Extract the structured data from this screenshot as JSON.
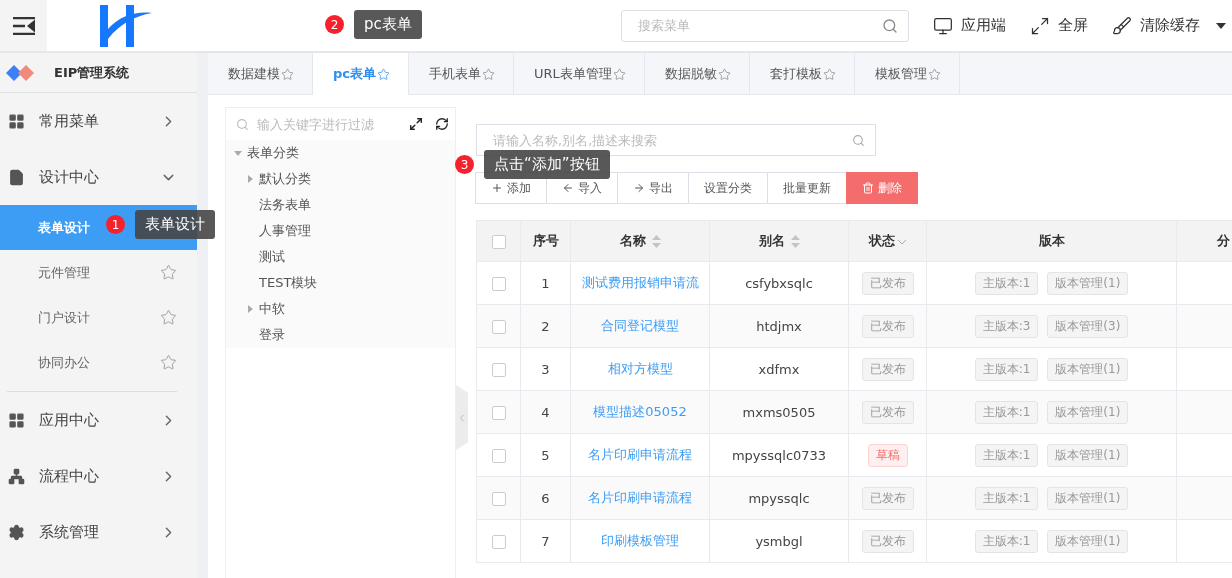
{
  "header": {
    "search": {
      "placeholder": "搜索菜单"
    },
    "actions": [
      {
        "label": "应用端"
      },
      {
        "label": "全屏"
      },
      {
        "label": "清除缓存",
        "dropdown": true
      }
    ]
  },
  "steps": [
    {
      "number": "2",
      "text": "pc表单"
    },
    {
      "number": "3",
      "text": "点击“添加”按钮"
    },
    {
      "number": "1",
      "text": "表单设计"
    }
  ],
  "sidebar": {
    "brand": "EIP管理系统",
    "menu": [
      {
        "label": "常用菜单",
        "expanded": false
      },
      {
        "label": "设计中心",
        "expanded": true,
        "children": [
          {
            "label": "表单设计",
            "selected": true
          },
          {
            "label": "元件管理",
            "selected": false
          },
          {
            "label": "门户设计",
            "selected": false
          },
          {
            "label": "协同办公",
            "selected": false
          }
        ]
      },
      {
        "label": "应用中心",
        "expanded": false
      },
      {
        "label": "流程中心",
        "expanded": false
      },
      {
        "label": "系统管理",
        "expanded": false
      }
    ]
  },
  "tabs": [
    {
      "label": "数据建模",
      "selected": false
    },
    {
      "label": "pc表单",
      "selected": true
    },
    {
      "label": "手机表单",
      "selected": false
    },
    {
      "label": "URL表单管理",
      "selected": false
    },
    {
      "label": "数据脱敏",
      "selected": false
    },
    {
      "label": "套打模板",
      "selected": false
    },
    {
      "label": "模板管理",
      "selected": false
    }
  ],
  "tree": {
    "placeholder": "输入关键字进行过滤",
    "nodes": [
      {
        "label": "表单分类",
        "expanded": true,
        "children": [
          {
            "label": "默认分类",
            "expanded": false
          },
          {
            "label": "法务表单"
          },
          {
            "label": "人事管理"
          },
          {
            "label": "测试"
          },
          {
            "label": "TEST模块"
          },
          {
            "label": "中软",
            "expanded": false
          },
          {
            "label": "登录"
          }
        ]
      }
    ]
  },
  "search": {
    "placeholder": "请输入名称,别名,描述来搜索"
  },
  "toolbar": [
    {
      "label": "添加",
      "kind": "add"
    },
    {
      "label": "导入",
      "kind": "import"
    },
    {
      "label": "导出",
      "kind": "export"
    },
    {
      "label": "设置分类",
      "kind": "plain"
    },
    {
      "label": "批量更新",
      "kind": "plain"
    },
    {
      "label": "删除",
      "kind": "danger"
    }
  ],
  "table": {
    "all_checked": false,
    "columns": [
      {
        "label": "序号"
      },
      {
        "label": "名称",
        "sortable": true
      },
      {
        "label": "别名",
        "sortable": true
      },
      {
        "label": "状态",
        "filterable": true
      },
      {
        "label": "版本"
      },
      {
        "label": "分"
      }
    ],
    "rows": [
      {
        "checked": false,
        "index": "1",
        "name": "测试费用报销申请流",
        "alias": "csfybxsqlc",
        "status": "已发布",
        "draft": false,
        "main_version": "主版本:1",
        "versions": "版本管理(1)"
      },
      {
        "checked": false,
        "index": "2",
        "name": "合同登记模型",
        "alias": "htdjmx",
        "status": "已发布",
        "draft": false,
        "main_version": "主版本:3",
        "versions": "版本管理(3)"
      },
      {
        "checked": false,
        "index": "3",
        "name": "相对方模型",
        "alias": "xdfmx",
        "status": "已发布",
        "draft": false,
        "main_version": "主版本:1",
        "versions": "版本管理(1)"
      },
      {
        "checked": false,
        "index": "4",
        "name": "模型描述05052",
        "alias": "mxms0505",
        "status": "已发布",
        "draft": false,
        "main_version": "主版本:1",
        "versions": "版本管理(1)"
      },
      {
        "checked": false,
        "index": "5",
        "name": "名片印刷申请流程",
        "alias": "mpyssqlc0733",
        "status": "草稿",
        "draft": true,
        "main_version": "主版本:1",
        "versions": "版本管理(1)"
      },
      {
        "checked": false,
        "index": "6",
        "name": "名片印刷申请流程",
        "alias": "mpyssqlc",
        "status": "已发布",
        "draft": false,
        "main_version": "主版本:1",
        "versions": "版本管理(1)"
      },
      {
        "checked": false,
        "index": "7",
        "name": "印刷模板管理",
        "alias": "ysmbgl",
        "status": "已发布",
        "draft": false,
        "main_version": "主版本:1",
        "versions": "版本管理(1)"
      }
    ]
  }
}
